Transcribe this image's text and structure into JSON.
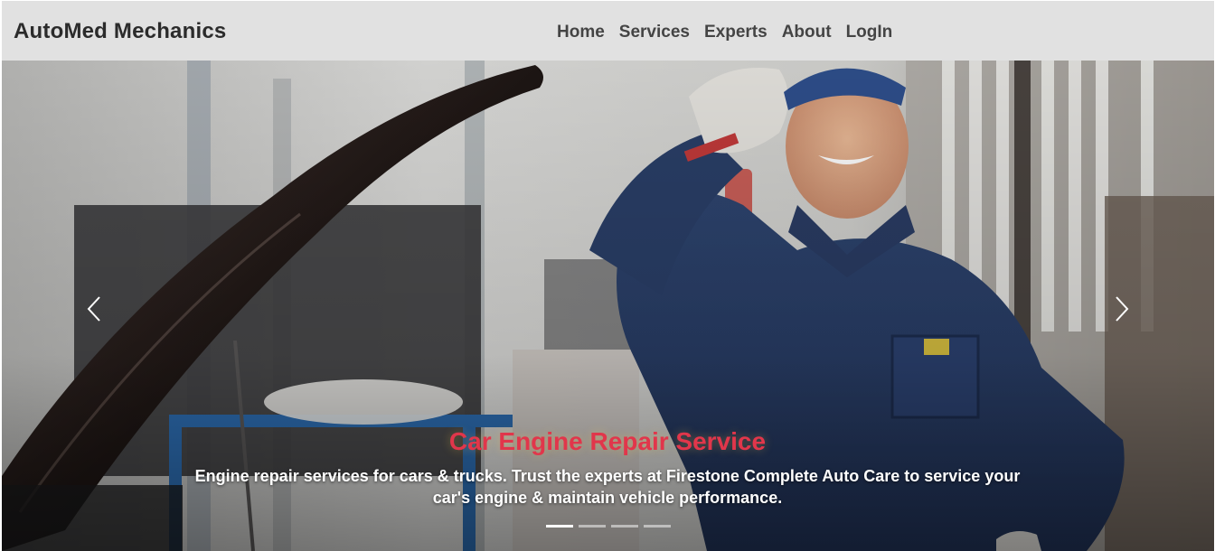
{
  "navbar": {
    "brand": "AutoMed Mechanics",
    "links": [
      {
        "label": "Home"
      },
      {
        "label": "Services"
      },
      {
        "label": "Experts"
      },
      {
        "label": "About"
      },
      {
        "label": "LogIn"
      }
    ],
    "background": "#e1e1e1"
  },
  "carousel": {
    "prev_icon": "chevron-left-icon",
    "next_icon": "chevron-right-icon",
    "slide": {
      "title": "Car Engine Repair Service",
      "text": "Engine repair services for cars & trucks. Trust the experts at Firestone Complete Auto Care to service your car's engine & maintain vehicle performance.",
      "title_color": "#e1364b"
    },
    "indicator_count": 4,
    "active_indicator": 1
  }
}
